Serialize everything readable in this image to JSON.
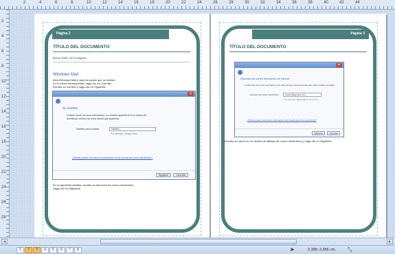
{
  "ruler": {
    "top_labels": [
      "2",
      "4",
      "6",
      "8",
      "10",
      "12",
      "14",
      "16",
      "18",
      "20",
      "22",
      "24",
      "26",
      "28",
      "30",
      "32",
      "34",
      "36",
      "38",
      "40",
      "42",
      "44"
    ],
    "left_labels": [
      "2",
      "4",
      "6",
      "8",
      "10",
      "12",
      "14",
      "16",
      "18",
      "20",
      "22",
      "24",
      "26",
      "28"
    ]
  },
  "left_page": {
    "tab": "Página 2",
    "title": "TÍTULO DEL DOCUMENTO",
    "subtitle": "Breve título de la página",
    "section_heading": "Windows Mail",
    "lines": [
      "Abra Windows Mail y siga los pasos que se indican",
      "En el menú Herramientas, haga clic en Cuentas",
      "Escriba su nombre y haga clic en Siguiente"
    ],
    "footer_lines": [
      "En la siguiente pantalla, escriba su dirección de correo electrónico",
      "Haga clic en Siguiente"
    ],
    "dialog": {
      "heading": "Su nombre",
      "text_1": "Cuando envíe un correo electrónico, su nombre aparecerá en el campo De.",
      "text_2": "Escriba su nombre tal como desea que aparezca.",
      "field_label": "Nombre para mostrar:",
      "field_value": "Usuario",
      "field_hint": "Por ejemplo: Sergio Ruiz",
      "link": "¿Dónde puedo encontrar la información de la cuenta de correo electrónico?",
      "next_button": "Siguiente",
      "cancel_button": "Cancelar"
    }
  },
  "right_page": {
    "tab": "Página 3",
    "title": "TÍTULO DEL DOCUMENTO",
    "caption": "Escriba su correo en el cuadro de diálogo de correo electrónico y haga clic en Siguiente",
    "dialog": {
      "heading": "Dirección de correo electrónico de Internet",
      "text_1": "La dirección de correo electrónico es la dirección que otras personas usan para enviarle mensajes.",
      "field_label": "Dirección de correo electrónico:",
      "field_value": "usuario@ejemplo.com",
      "field_hint": "Por ejemplo: alguien@microsoft.com",
      "link": "¿Dónde puedo encontrar la información de la cuenta de correo electrónico?",
      "next_button": "Siguiente",
      "cancel_button": "Cancelar"
    }
  },
  "status": {
    "pages": [
      "1",
      "2",
      "3",
      "4",
      "5",
      "6",
      "7",
      "8"
    ],
    "active_pages": [
      "2",
      "3"
    ],
    "coordinates": "2,396; 2,356 cm.",
    "cursor_icon": "pointer-arrow-icon",
    "size_icon": "object-size-icon"
  },
  "scrollbar": {
    "left_arrow": "◄",
    "right_arrow": "►"
  }
}
